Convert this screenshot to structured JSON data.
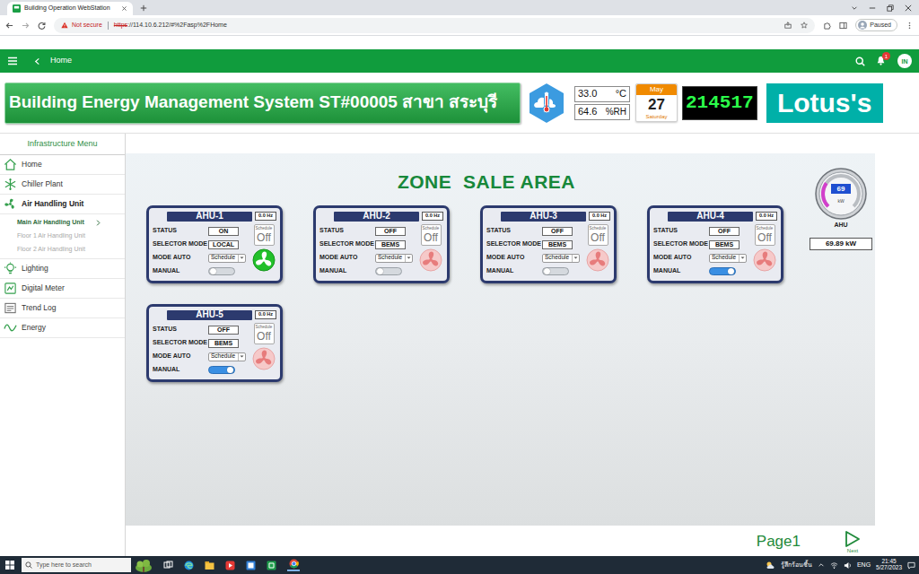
{
  "browser": {
    "tab_title": "Building Operation WebStation",
    "security": "Not secure",
    "url_scheme": "https",
    "url_rest": "://114.10.6.212/#%2Fasp%2FHome",
    "profile": "Paused"
  },
  "app_bar": {
    "crumb": "Home",
    "notifications": "1",
    "user": "IN"
  },
  "header": {
    "title": "Building Energy Management System ST#00005 สาขา สระบุรี",
    "temperature": "33.0",
    "temperature_unit": "°C",
    "humidity": "64.6",
    "humidity_unit": "%RH",
    "month": "May",
    "day": "27",
    "weekday": "Saturday",
    "clock": "214517",
    "logo": "Lotus's"
  },
  "sidebar": {
    "title": "Infrastructure Menu",
    "items": [
      {
        "label": "Home"
      },
      {
        "label": "Chiller Plant"
      },
      {
        "label": "Air Handling Unit",
        "expanded": true,
        "children": [
          {
            "label": "Main Air Handling Unit",
            "selected": true
          },
          {
            "label": "Floor 1 Air Handling Unit",
            "selected": false
          },
          {
            "label": "Floor 2 Air Handling Unit",
            "selected": false
          }
        ]
      },
      {
        "label": "Lighting"
      },
      {
        "label": "Digital Meter"
      },
      {
        "label": "Trend Log"
      },
      {
        "label": "Energy"
      }
    ]
  },
  "zone": {
    "title": "ZONE  SALE AREA",
    "units": [
      {
        "name": "AHU-1",
        "frequency": "0.0 Hz",
        "status_label": "STATUS",
        "status": "ON",
        "selector_label": "SELECTOR MODE",
        "selector": "LOCAL",
        "mode_label": "MODE AUTO",
        "mode": "Schedule",
        "manual_label": "MANUAL",
        "manual_on": false,
        "schedule_label": "Schedule",
        "schedule_value": "Off",
        "running": true
      },
      {
        "name": "AHU-2",
        "frequency": "0.0 Hz",
        "status_label": "STATUS",
        "status": "OFF",
        "selector_label": "SELECTOR MODE",
        "selector": "BEMS",
        "mode_label": "MODE AUTO",
        "mode": "Schedule",
        "manual_label": "MANUAL",
        "manual_on": false,
        "schedule_label": "Schedule",
        "schedule_value": "Off",
        "running": false
      },
      {
        "name": "AHU-3",
        "frequency": "0.0 Hz",
        "status_label": "STATUS",
        "status": "OFF",
        "selector_label": "SELECTOR MODE",
        "selector": "BEMS",
        "mode_label": "MODE AUTO",
        "mode": "Schedule",
        "manual_label": "MANUAL",
        "manual_on": false,
        "schedule_label": "Schedule",
        "schedule_value": "Off",
        "running": false
      },
      {
        "name": "AHU-4",
        "frequency": "0.0 Hz",
        "status_label": "STATUS",
        "status": "OFF",
        "selector_label": "SELECTOR MODE",
        "selector": "BEMS",
        "mode_label": "MODE AUTO",
        "mode": "Schedule",
        "manual_label": "MANUAL",
        "manual_on": true,
        "schedule_label": "Schedule",
        "schedule_value": "Off",
        "running": false
      },
      {
        "name": "AHU-5",
        "frequency": "0.0 Hz",
        "status_label": "STATUS",
        "status": "OFF",
        "selector_label": "SELECTOR MODE",
        "selector": "BEMS",
        "mode_label": "MODE AUTO",
        "mode": "Schedule",
        "manual_label": "MANUAL",
        "manual_on": true,
        "schedule_label": "Schedule",
        "schedule_value": "Off",
        "running": false
      }
    ],
    "gauge": {
      "value": "69",
      "unit": "kW",
      "label": "AHU",
      "reading": "69.89 kW",
      "level": 0.3
    }
  },
  "pager": {
    "page": "Page1",
    "next": "Next"
  },
  "taskbar": {
    "search": "Type here to search",
    "weather": "รู้สึกร้อนชื้น",
    "language": "ENG",
    "time": "21:45",
    "date": "5/27/2023"
  }
}
